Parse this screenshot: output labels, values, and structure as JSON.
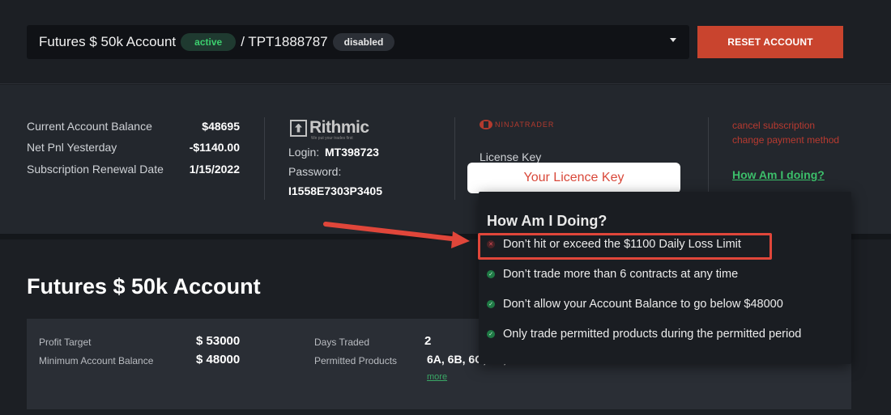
{
  "header": {
    "account_name": "Futures $ 50k Account",
    "account_status": "active",
    "separator_text": "/ TPT1888787",
    "sub_status": "disabled",
    "reset_button": "RESET ACCOUNT"
  },
  "summary": {
    "rows": [
      {
        "label": "Current Account Balance",
        "value": "$48695"
      },
      {
        "label": "Net Pnl Yesterday",
        "value": "-$1140.00"
      },
      {
        "label": "Subscription Renewal Date",
        "value": "1/15/2022"
      }
    ]
  },
  "rithmic": {
    "logo_text": "Rithmic",
    "tagline": "We put your trades first",
    "login_label": "Login:",
    "login_value": "MT398723",
    "password_label": "Password:",
    "password_value": "I1558E7303P3405"
  },
  "ninjatrader": {
    "logo_text": "NINJATRADER",
    "license_label": "License Key",
    "license_value": "Your Licence Key"
  },
  "links": {
    "cancel": "cancel subscription",
    "change_payment": "change payment method",
    "how_am_i_doing": "How Am I doing?"
  },
  "main": {
    "title": "Futures $ 50k Account",
    "details": [
      {
        "label": "Profit Target",
        "value": "$ 53000"
      },
      {
        "label": "Minimum Account Balance",
        "value": "$ 48000"
      },
      {
        "label": "Days Traded",
        "value": "2"
      },
      {
        "label": "Permitted Products",
        "value": "6A, 6B, 6C, 6E, 6J"
      }
    ],
    "more_link": "more"
  },
  "popover": {
    "title": "How Am I Doing?",
    "rules": [
      {
        "text": "Don’t hit or exceed the $1100 Daily Loss Limit",
        "status": "fail"
      },
      {
        "text": "Don’t trade more than 6 contracts at any time",
        "status": "ok"
      },
      {
        "text": "Don’t allow your Account Balance to go below $48000",
        "status": "ok"
      },
      {
        "text": "Only trade permitted products during the permitted period",
        "status": "ok"
      }
    ]
  },
  "colors": {
    "accent_red": "#c9442e",
    "success_green": "#3ccf6e",
    "annotation_red": "#e0463a"
  }
}
